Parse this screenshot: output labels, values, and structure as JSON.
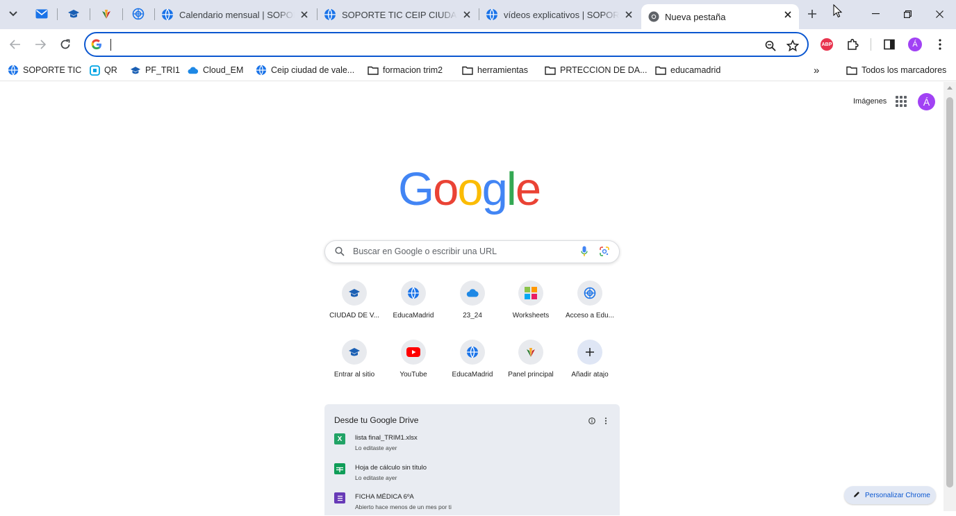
{
  "window": {
    "tabs": [
      {
        "title": "Calendario mensual | SOPORTE TIC",
        "icon": "globe-icon"
      },
      {
        "title": "SOPORTE TIC CEIP CIUDAD DE VALENCIA",
        "icon": "globe-icon"
      },
      {
        "title": "vídeos explicativos | SOPORTE TIC",
        "icon": "globe-icon"
      },
      {
        "title": "Nueva pestaña",
        "icon": "chrome-icon",
        "active": true
      }
    ],
    "pinned_tabs": [
      "gmail-icon",
      "graduation-cap-icon",
      "raices-icon",
      "educamadrid-icon"
    ]
  },
  "toolbar": {
    "omnibox_value": "",
    "profile_initial": "Á"
  },
  "bookmarks": {
    "items": [
      {
        "label": "SOPORTE TIC",
        "icon": "globe-icon"
      },
      {
        "label": "QR",
        "icon": "qr-icon"
      },
      {
        "label": "PF_TRI1",
        "icon": "graduation-cap-icon"
      },
      {
        "label": "Cloud_EM",
        "icon": "cloud-icon"
      },
      {
        "label": "Ceip ciudad de vale...",
        "icon": "globe-icon"
      },
      {
        "label": "formacion trim2",
        "icon": "folder-icon"
      },
      {
        "label": "herramientas",
        "icon": "folder-icon"
      },
      {
        "label": "PRTECCION DE DA...",
        "icon": "folder-icon"
      },
      {
        "label": "educamadrid",
        "icon": "folder-icon"
      }
    ],
    "overflow": "»",
    "all_bookmarks": "Todos los marcadores"
  },
  "ntp": {
    "images_link": "Imágenes",
    "avatar_initial": "Á",
    "logo_letters": [
      "G",
      "o",
      "o",
      "g",
      "l",
      "e"
    ],
    "logo_colors": [
      "#4285f4",
      "#ea4335",
      "#fbbc05",
      "#4285f4",
      "#34a853",
      "#ea4335"
    ],
    "search_placeholder": "Buscar en Google o escribir una URL",
    "shortcuts": [
      {
        "label": "CIUDAD DE V...",
        "icon": "graduation-cap-icon"
      },
      {
        "label": "EducaMadrid",
        "icon": "globe-icon"
      },
      {
        "label": "23_24",
        "icon": "cloud-icon"
      },
      {
        "label": "Worksheets",
        "icon": "worksheets-icon"
      },
      {
        "label": "Acceso a Edu...",
        "icon": "educamadrid-icon"
      },
      {
        "label": "Entrar al sitio",
        "icon": "graduation-cap-icon"
      },
      {
        "label": "YouTube",
        "icon": "youtube-icon"
      },
      {
        "label": "EducaMadrid",
        "icon": "globe-icon"
      },
      {
        "label": "Panel principal",
        "icon": "raices-icon"
      },
      {
        "label": "Añadir atajo",
        "icon": "plus-icon"
      }
    ],
    "drive": {
      "heading": "Desde tu Google Drive",
      "files": [
        {
          "name": "lista final_TRIM1.xlsx",
          "sub": "Lo editaste ayer",
          "icon": "excel-icon",
          "color": "#21a366"
        },
        {
          "name": "Hoja de cálculo sin título",
          "sub": "Lo editaste ayer",
          "icon": "sheets-icon",
          "color": "#0f9d58"
        },
        {
          "name": "FICHA MÉDICA 6ºA",
          "sub": "Abierto hace menos de un mes por ti",
          "icon": "forms-icon",
          "color": "#673ab7"
        }
      ]
    },
    "customize_label": "Personalizar Chrome"
  },
  "colors": {
    "accent": "#0b57d0",
    "tabstrip_bg": "#dfe3ee",
    "avatar": "#a142f4"
  }
}
